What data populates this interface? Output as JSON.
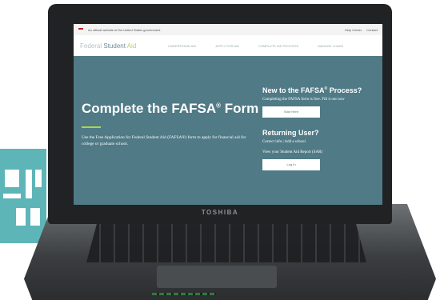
{
  "laptop": {
    "brand": "TOSHIBA"
  },
  "gov_banner": {
    "text": "An official website of the United States government",
    "links": [
      "Help Center",
      "Contact"
    ]
  },
  "site_header": {
    "logo_prefix": "Federal ",
    "logo_main": "Student",
    "logo_suffix": " Aid",
    "nav": [
      "UNDERSTAND AID",
      "APPLY FOR AID",
      "COMPLETE AID PROCESS",
      "MANAGE LOANS"
    ]
  },
  "hero": {
    "title": "Complete the FAFSA",
    "title_mark": "®",
    "title_suffix": " Form",
    "description": "Use the Free Application for Federal Student Aid (FAFSA®) form to apply for financial aid for college or graduate school."
  },
  "new_user": {
    "title": "New to the FAFSA",
    "title_mark": "®",
    "title_suffix": " Process?",
    "text": "Completing the FAFSA form is free. Fill it out now",
    "button": "Start Here"
  },
  "returning_user": {
    "title": "Returning User?",
    "text1": "Correct info  |  Add a school",
    "text2": "View your Student Aid Report (SAR)",
    "button": "Log In"
  },
  "colors": {
    "hero_bg": "#4f7a86",
    "accent_green": "#a7d84a",
    "tiles": "#5db5b8"
  }
}
